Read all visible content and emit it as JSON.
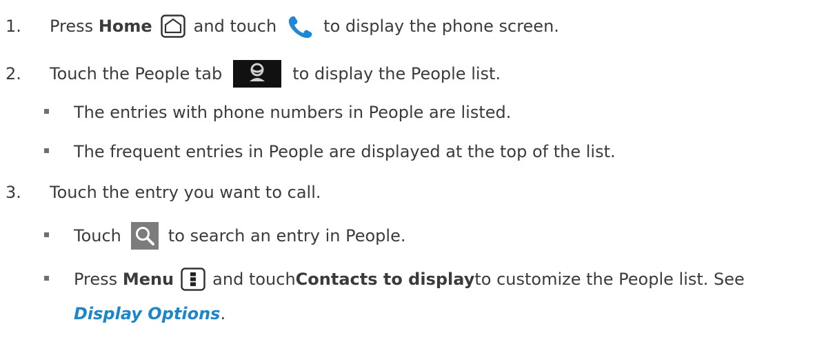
{
  "step1": {
    "number": "1.",
    "press": "Press ",
    "home": "Home",
    "and_touch": "and touch",
    "rest": "to display the phone screen.",
    "icons": [
      "home-key-icon",
      "phone-icon"
    ]
  },
  "step2": {
    "number": "2.",
    "before": "Touch the People tab",
    "rest": "to display the People list.",
    "icons": [
      "people-tab-icon"
    ],
    "bullets": [
      "The entries with phone numbers in People are listed.",
      "The frequent entries in People are displayed at the top of the list."
    ]
  },
  "step3": {
    "number": "3.",
    "text": "Touch the entry you want to call.",
    "bullet_search": {
      "before": "Touch",
      "rest": "to search an entry in People.",
      "icon": "search-icon"
    },
    "bullet_menu": {
      "press": "Press ",
      "menu": "Menu",
      "and_touch": " and touch ",
      "contacts": "Contacts to display",
      "rest": " to customize the People list. See",
      "link": "Display Options",
      "end": ".",
      "icon": "menu-key-icon"
    }
  },
  "colors": {
    "text": "#3b3b3b",
    "link": "#1c86c8",
    "phone_icon": "#1e88d4",
    "people_tab_bg": "#111111"
  }
}
